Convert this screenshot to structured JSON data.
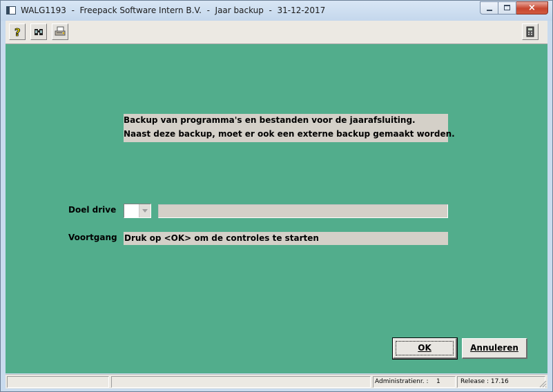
{
  "window": {
    "title": "WALG1193  -  Freepack Software Intern B.V.  -  Jaar backup  -  31-12-2017",
    "close_label": "×"
  },
  "toolbar": {
    "buttons": [
      {
        "icon": "help-icon"
      },
      {
        "icon": "binoculars-icon"
      },
      {
        "icon": "printer-icon"
      }
    ],
    "right_button": {
      "icon": "calculator-icon"
    }
  },
  "info": {
    "line1": "Backup van programma's en bestanden voor de jaarafsluiting.",
    "line2": "Naast deze backup, moet er ook een externe backup gemaakt worden."
  },
  "form": {
    "drive_label": "Doel drive",
    "drive_value": "",
    "drive_path": "",
    "progress_label": "Voortgang",
    "progress_text": "Druk op <OK> om de controles te starten"
  },
  "buttons": {
    "ok_label": "OK",
    "cancel_label": "Annuleren"
  },
  "statusbar": {
    "panel1": "",
    "panel2": "",
    "admin": "Administratienr. :    1",
    "release": "Release : 17.16"
  },
  "colors": {
    "background": "#52ad8c",
    "field_gray": "#d4d0c8"
  }
}
